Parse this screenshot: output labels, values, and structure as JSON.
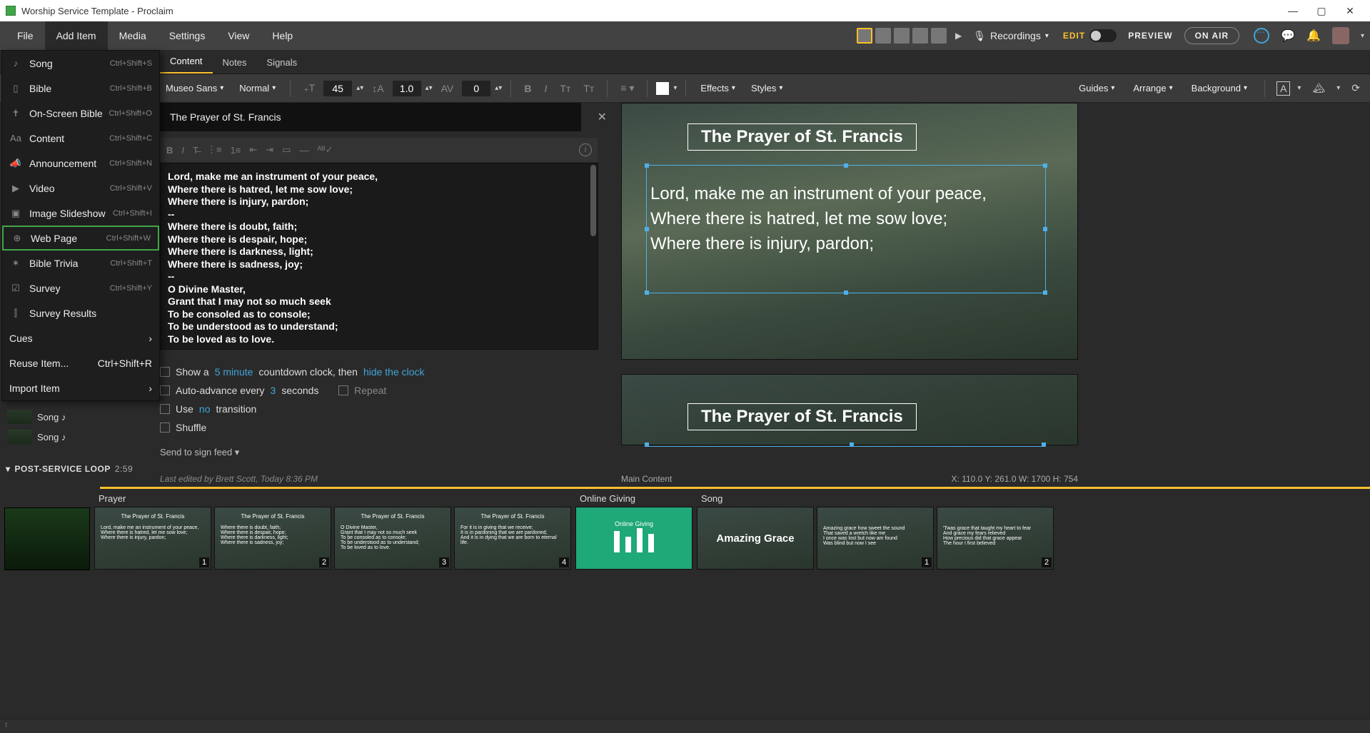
{
  "titlebar": {
    "title": "Worship Service Template - Proclaim"
  },
  "menubar": {
    "items": [
      "File",
      "Add Item",
      "Media",
      "Settings",
      "View",
      "Help"
    ],
    "active": "Add Item",
    "recordings": "Recordings",
    "edit": "EDIT",
    "preview": "PREVIEW",
    "onair": "ON AIR"
  },
  "tabs": {
    "items": [
      "Content",
      "Notes",
      "Signals"
    ],
    "active": "Content"
  },
  "toolbar": {
    "font": "Museo Sans",
    "weight": "Normal",
    "size": "45",
    "lineheight": "1.0",
    "tracking": "0",
    "effects": "Effects",
    "styles": "Styles",
    "guides": "Guides",
    "arrange": "Arrange",
    "background": "Background"
  },
  "dropdown": {
    "items": [
      {
        "icon": "♪",
        "label": "Song",
        "shortcut": "Ctrl+Shift+S"
      },
      {
        "icon": "▯",
        "label": "Bible",
        "shortcut": "Ctrl+Shift+B"
      },
      {
        "icon": "✝",
        "label": "On-Screen Bible",
        "shortcut": "Ctrl+Shift+O"
      },
      {
        "icon": "Aa",
        "label": "Content",
        "shortcut": "Ctrl+Shift+C"
      },
      {
        "icon": "📣",
        "label": "Announcement",
        "shortcut": "Ctrl+Shift+N"
      },
      {
        "icon": "▶",
        "label": "Video",
        "shortcut": "Ctrl+Shift+V"
      },
      {
        "icon": "▣",
        "label": "Image Slideshow",
        "shortcut": "Ctrl+Shift+I"
      },
      {
        "icon": "⊕",
        "label": "Web Page",
        "shortcut": "Ctrl+Shift+W",
        "highlight": true
      },
      {
        "icon": "✶",
        "label": "Bible Trivia",
        "shortcut": "Ctrl+Shift+T"
      },
      {
        "icon": "☑",
        "label": "Survey",
        "shortcut": "Ctrl+Shift+Y"
      },
      {
        "icon": "⫿",
        "label": "Survey Results",
        "shortcut": ""
      }
    ],
    "cues": "Cues",
    "reuse": {
      "label": "Reuse Item...",
      "shortcut": "Ctrl+Shift+R"
    },
    "import": "Import Item"
  },
  "sidebar_remnant": {
    "song1": "Song ♪",
    "song2": "Song ♪"
  },
  "section_header": {
    "label": "POST-SERVICE LOOP",
    "time": "2:59"
  },
  "editor": {
    "title": "The Prayer of St. Francis",
    "lyrics": "Lord, make me an instrument of your peace,\nWhere there is hatred, let me sow love;\nWhere there is injury, pardon;\n--\nWhere there is doubt, faith;\nWhere there is despair, hope;\nWhere there is darkness, light;\nWhere there is sadness, joy;\n--\nO Divine Master,\nGrant that I may not so much seek\nTo be consoled as to console;\nTo be understood as to understand;\nTo be loved as to love.\n--",
    "options": {
      "show_a": "Show a ",
      "countdown_val": "5 minute",
      "countdown_rest": " countdown clock, then ",
      "hide_clock": "hide the clock",
      "auto_pre": "Auto-advance every ",
      "auto_val": "3",
      "auto_post": " seconds",
      "repeat": "Repeat",
      "use": "Use ",
      "no": "no",
      "transition": " transition",
      "shuffle": "Shuffle"
    },
    "signfeed": "Send to sign feed ▾",
    "footer": "Last edited by Brett Scott, Today 8:36 PM"
  },
  "preview": {
    "title": "The Prayer of St. Francis",
    "body": "Lord, make me an instrument of your peace,\nWhere there is hatred, let me sow love;\nWhere there is injury, pardon;",
    "footer_left": "Main Content",
    "footer_right": "X: 110.0  Y: 261.0   W: 1700  H: 754"
  },
  "thumbs": {
    "group1": {
      "header": "Prayer",
      "slides": [
        {
          "title": "The Prayer of St. Francis",
          "body": "Lord, make me an instrument of your peace,\nWhere there is hatred, let me sow love;\nWhere there is injury, pardon;",
          "num": "1"
        },
        {
          "title": "The Prayer of St. Francis",
          "body": "Where there is doubt, faith;\nWhere there is despair, hope;\nWhere there is darkness, light;\nWhere there is sadness, joy;",
          "num": "2"
        },
        {
          "title": "The Prayer of St. Francis",
          "body": "O Divine Master,\nGrant that I may not so much seek\nTo be consoled as to console;\nTo be understood as to understand;\nTo be loved as to love.",
          "num": "3"
        },
        {
          "title": "The Prayer of St. Francis",
          "body": "For it is in giving that we receive;\nIt is in pardoning that we are pardoned;\nAnd it is in dying that we are born to eternal life.",
          "num": "4"
        }
      ]
    },
    "group2": {
      "header": "Online Giving",
      "label": "Online Giving"
    },
    "group3": {
      "header": "Song",
      "title_slide": "Amazing Grace",
      "slides": [
        {
          "body": "Amazing grace how sweet the sound\nThat saved a wretch like me\nI once was lost but now am found\nWas blind but now I see",
          "num": "1"
        },
        {
          "body": "'Twas grace that taught my heart to fear\nAnd grace my fears relieved\nHow precious did that grace appear\nThe hour I first believed",
          "num": "2"
        }
      ]
    }
  }
}
